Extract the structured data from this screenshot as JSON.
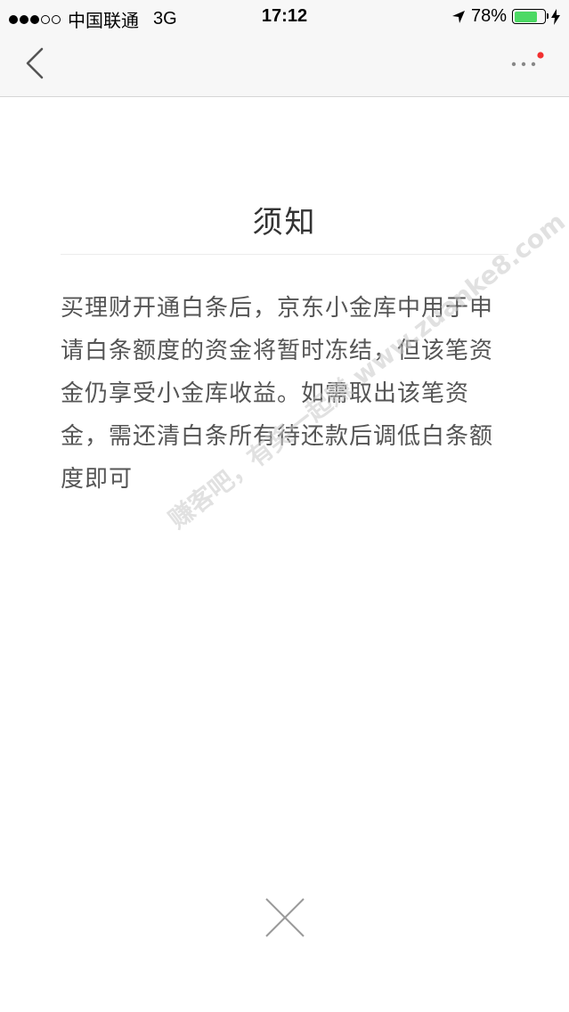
{
  "status_bar": {
    "carrier": "中国联通",
    "network": "3G",
    "time": "17:12",
    "battery_percent": "78%",
    "battery_level": 0.78,
    "signal_bars_filled": 3,
    "signal_bars_total": 5
  },
  "nav": {
    "back_icon": "chevron-left-icon",
    "more_icon": "more-dots-icon",
    "notification_dot_color": "#f23030"
  },
  "notice": {
    "title": "须知",
    "body": "买理财开通白条后，京东小金库中用于申请白条额度的资金将暂时冻结，但该笔资金仍享受小金库收益。如需取出该笔资金，需还清白条所有待还款后调低白条额度即可"
  },
  "watermark": "赚客吧，有奖一起赚 www.zuanke8.com",
  "close_icon": "close-x-icon",
  "colors": {
    "battery": "#4cd964",
    "text": "#555555",
    "title": "#333333"
  }
}
